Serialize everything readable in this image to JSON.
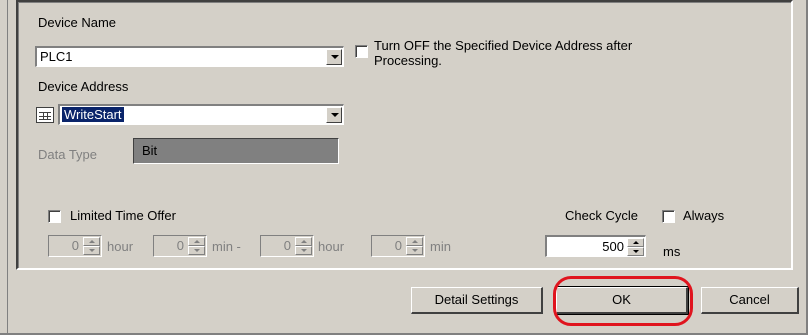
{
  "device_name": {
    "label": "Device Name",
    "value": "PLC1"
  },
  "turn_off": {
    "label_line1": "Turn OFF the Specified Device Address after",
    "label_line2": "Processing.",
    "checked": false
  },
  "device_address": {
    "label": "Device Address",
    "value": "WriteStart"
  },
  "data_type": {
    "label": "Data Type",
    "value": "Bit"
  },
  "limited_time": {
    "label": "Limited Time Offer",
    "checked": false,
    "spinners": [
      {
        "value": "0",
        "unit": "hour"
      },
      {
        "value": "0",
        "unit": "min -"
      },
      {
        "value": "0",
        "unit": "hour"
      },
      {
        "value": "0",
        "unit": "min"
      }
    ]
  },
  "check_cycle": {
    "label": "Check Cycle",
    "always_label": "Always",
    "always_checked": false,
    "value": "500",
    "unit": "ms"
  },
  "buttons": {
    "detail_settings": "Detail Settings",
    "ok": "OK",
    "cancel": "Cancel"
  },
  "colors": {
    "highlight": "#e0141e",
    "selection": "#0a246a",
    "face": "#d4d0c8"
  }
}
